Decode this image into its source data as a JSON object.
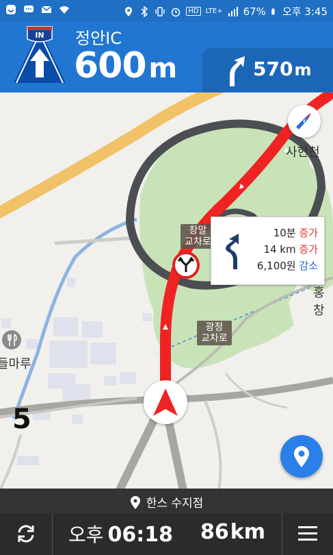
{
  "status_bar": {
    "battery": "67%",
    "time": "오후 3:45",
    "network": "LTE+",
    "hd_label": "HD"
  },
  "header": {
    "exit_sign": "IN",
    "place_name": "정안IC",
    "distance_value": "600",
    "distance_unit": "m",
    "next_distance_value": "570",
    "next_distance_unit": "m"
  },
  "map": {
    "labels": {
      "sahyeon": "사현천",
      "hong": "홍창",
      "dulmaru": "들마루",
      "changmal": "창말\n교차로",
      "gwangjeong": "광정\n교차로"
    },
    "route_info": {
      "time_value": "10분",
      "time_change": "증가",
      "dist_value": "14 km",
      "dist_change": "증가",
      "cost_value": "6,100원",
      "cost_change": "감소"
    },
    "speed_number": "5",
    "colors": {
      "route": "#f02323",
      "increase": "#e53935",
      "decrease": "#1e63d0",
      "header": "#2176d2"
    }
  },
  "destination": {
    "name": "한스 수지점"
  },
  "bottom_bar": {
    "eta_ampm": "오후",
    "eta_time": "06:18",
    "remaining_value": "86",
    "remaining_unit": "km",
    "icons": [
      "refresh-icon",
      "menu-icon"
    ]
  }
}
